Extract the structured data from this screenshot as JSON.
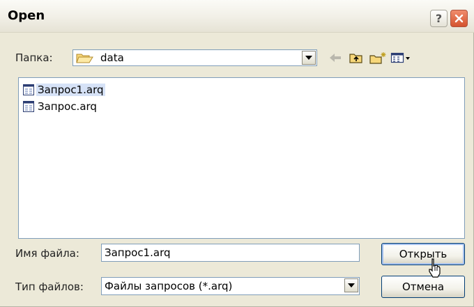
{
  "window": {
    "title": "Open"
  },
  "titlebar": {
    "help_glyph": "?",
    "close_icon": "close-icon"
  },
  "lookin": {
    "label": "Папка:",
    "folder": "data",
    "folder_icon": "folder-icon"
  },
  "toolbar": {
    "icons": [
      "back-arrow-icon",
      "up-folder-icon",
      "new-folder-icon",
      "view-menu-icon"
    ]
  },
  "files": [
    {
      "name": "Запрос1.arq",
      "selected": true,
      "icon": "arq-file-icon"
    },
    {
      "name": "Запрос.arq",
      "selected": false,
      "icon": "arq-file-icon"
    }
  ],
  "filename": {
    "label": "Имя файла:",
    "value": "Запрос1.arq"
  },
  "filetype": {
    "label": "Тип файлов:",
    "value": "Файлы запросов (*.arq)"
  },
  "buttons": {
    "open": "Открыть",
    "cancel": "Отмена"
  },
  "colors": {
    "accent": "#003c74",
    "selection": "#d6e2f7",
    "field_border": "#7f9db9",
    "dialog_bg": "#ece9d8"
  }
}
